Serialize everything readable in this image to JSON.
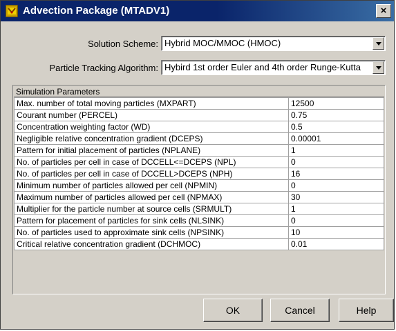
{
  "window": {
    "title": "Advection Package (MTADV1)",
    "close_label": "×"
  },
  "form": {
    "solution_scheme_label": "Solution Scheme:",
    "solution_scheme_value": "Hybrid MOC/MMOC (HMOC)",
    "tracking_label": "Particle Tracking Algorithm:",
    "tracking_value": "Hybird 1st order Euler and 4th order Runge-Kutta"
  },
  "grid": {
    "header": "Simulation Parameters",
    "rows": [
      {
        "name": "Max. number of total moving particles (MXPART)",
        "value": "12500"
      },
      {
        "name": "Courant number (PERCEL)",
        "value": "0.75"
      },
      {
        "name": "Concentration weighting factor (WD)",
        "value": "0.5"
      },
      {
        "name": "Negligible relative concentration gradient (DCEPS)",
        "value": "0.00001"
      },
      {
        "name": "Pattern for initial placement of particles (NPLANE)",
        "value": "1"
      },
      {
        "name": "No. of particles per cell in case of DCCELL<=DCEPS (NPL)",
        "value": "0"
      },
      {
        "name": "No. of particles per cell in case of DCCELL>DCEPS (NPH)",
        "value": "16"
      },
      {
        "name": "Minimum number of particles allowed per cell (NPMIN)",
        "value": "0"
      },
      {
        "name": "Maximum number of particles allowed per cell (NPMAX)",
        "value": "30"
      },
      {
        "name": "Multiplier for the particle number at source cells (SRMULT)",
        "value": "1"
      },
      {
        "name": "Pattern for placement of particles for sink cells (NLSINK)",
        "value": "0"
      },
      {
        "name": "No. of particles used to approximate sink cells (NPSINK)",
        "value": "10"
      },
      {
        "name": "Critical relative concentration gradient (DCHMOC)",
        "value": "0.01"
      }
    ]
  },
  "buttons": {
    "ok": "OK",
    "cancel": "Cancel",
    "help": "Help"
  },
  "icons": {
    "app": "app-icon",
    "close": "close-icon",
    "dropdown": "chevron-down-icon"
  }
}
